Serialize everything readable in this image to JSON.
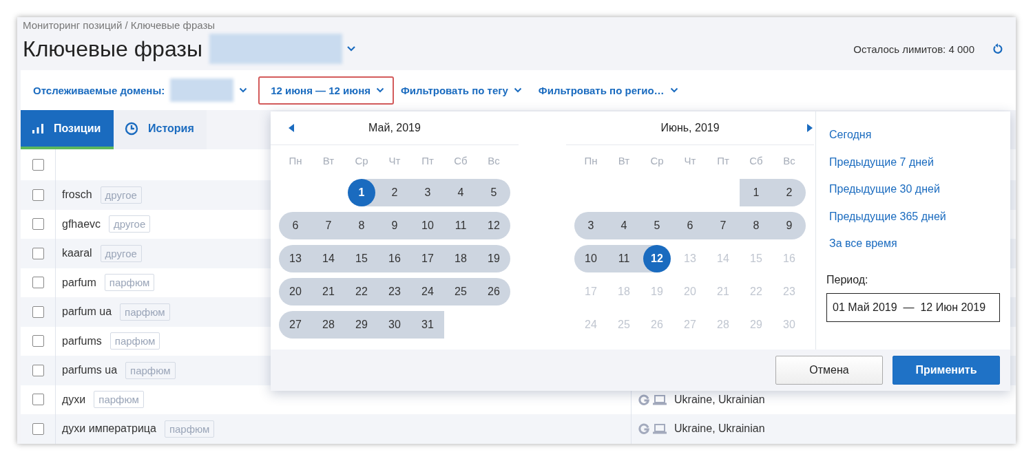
{
  "breadcrumb": "Мониторинг позиций / Ключевые фразы",
  "title": "Ключевые фразы",
  "limits": "Осталось лимитов: 4 000",
  "filters": [
    {
      "kind": "domains",
      "label": "Отслеживаемые домены:",
      "active": false
    },
    {
      "kind": "date",
      "label": "12 июня — 12 июня",
      "active": true
    },
    {
      "kind": "plain",
      "label": "Фильтровать по тегу",
      "active": false
    },
    {
      "kind": "plain",
      "label": "Фильтровать по регио…",
      "active": false
    }
  ],
  "tabs": [
    {
      "kind": "positions",
      "label": "Позиции",
      "selected": true
    },
    {
      "kind": "history",
      "label": "История",
      "selected": false
    }
  ],
  "table": {
    "header_checked": false,
    "rows": [
      {
        "phrase": "frosch",
        "tag": "другое",
        "checked": false
      },
      {
        "phrase": "gfhaevc",
        "tag": "другое",
        "checked": false
      },
      {
        "phrase": "kaaral",
        "tag": "другое",
        "checked": false
      },
      {
        "phrase": "parfum",
        "tag": "парфюм",
        "checked": false
      },
      {
        "phrase": "parfum ua",
        "tag": "парфюм",
        "checked": false
      },
      {
        "phrase": "parfums",
        "tag": "парфюм",
        "checked": false
      },
      {
        "phrase": "parfums ua",
        "tag": "парфюм",
        "checked": false
      },
      {
        "phrase": "духи",
        "tag": "парфюм",
        "checked": false,
        "region": "Ukraine, Ukrainian"
      },
      {
        "phrase": "духи императрица",
        "tag": "парфюм",
        "checked": false,
        "region": "Ukraine, Ukrainian"
      }
    ]
  },
  "datepicker": {
    "months": [
      {
        "title": "Май, 2019",
        "prev": true,
        "next": false,
        "weekdays": [
          "Пн",
          "Вт",
          "Ср",
          "Чт",
          "Пт",
          "Сб",
          "Вс"
        ],
        "weeks": [
          [
            {
              "day": "1",
              "selected": true,
              "in_range": true
            },
            {
              "day": "2",
              "selected": false,
              "in_range": true
            },
            {
              "day": "3",
              "selected": false,
              "in_range": true
            },
            {
              "day": "4",
              "selected": false,
              "in_range": true
            },
            {
              "day": "5",
              "selected": false,
              "in_range": true
            }
          ],
          [
            {
              "day": "6",
              "selected": false,
              "in_range": true
            },
            {
              "day": "7",
              "selected": false,
              "in_range": true
            },
            {
              "day": "8",
              "selected": false,
              "in_range": true
            },
            {
              "day": "9",
              "selected": false,
              "in_range": true
            },
            {
              "day": "10",
              "selected": false,
              "in_range": true
            },
            {
              "day": "11",
              "selected": false,
              "in_range": true
            },
            {
              "day": "12",
              "selected": false,
              "in_range": true
            }
          ],
          [
            {
              "day": "13",
              "selected": false,
              "in_range": true
            },
            {
              "day": "14",
              "selected": false,
              "in_range": true
            },
            {
              "day": "15",
              "selected": false,
              "in_range": true
            },
            {
              "day": "16",
              "selected": false,
              "in_range": true
            },
            {
              "day": "17",
              "selected": false,
              "in_range": true
            },
            {
              "day": "18",
              "selected": false,
              "in_range": true
            },
            {
              "day": "19",
              "selected": false,
              "in_range": true
            }
          ],
          [
            {
              "day": "20",
              "selected": false,
              "in_range": true
            },
            {
              "day": "21",
              "selected": false,
              "in_range": true
            },
            {
              "day": "22",
              "selected": false,
              "in_range": true
            },
            {
              "day": "23",
              "selected": false,
              "in_range": true
            },
            {
              "day": "24",
              "selected": false,
              "in_range": true
            },
            {
              "day": "25",
              "selected": false,
              "in_range": true
            },
            {
              "day": "26",
              "selected": false,
              "in_range": true
            }
          ],
          [
            {
              "day": "27",
              "selected": false,
              "in_range": true
            },
            {
              "day": "28",
              "selected": false,
              "in_range": true
            },
            {
              "day": "29",
              "selected": false,
              "in_range": true
            },
            {
              "day": "30",
              "selected": false,
              "in_range": true
            },
            {
              "day": "31",
              "selected": false,
              "in_range": true
            }
          ]
        ]
      },
      {
        "title": "Июнь, 2019",
        "prev": false,
        "next": true,
        "weekdays": [
          "Пн",
          "Вт",
          "Ср",
          "Чт",
          "Пт",
          "Сб",
          "Вс"
        ],
        "weeks": [
          [
            {
              "day": "1",
              "selected": false,
              "in_range": true
            },
            {
              "day": "2",
              "selected": false,
              "in_range": true
            }
          ],
          [
            {
              "day": "3",
              "selected": false,
              "in_range": true
            },
            {
              "day": "4",
              "selected": false,
              "in_range": true
            },
            {
              "day": "5",
              "selected": false,
              "in_range": true
            },
            {
              "day": "6",
              "selected": false,
              "in_range": true
            },
            {
              "day": "7",
              "selected": false,
              "in_range": true
            },
            {
              "day": "8",
              "selected": false,
              "in_range": true
            },
            {
              "day": "9",
              "selected": false,
              "in_range": true
            }
          ],
          [
            {
              "day": "10",
              "selected": false,
              "in_range": true
            },
            {
              "day": "11",
              "selected": false,
              "in_range": true
            },
            {
              "day": "12",
              "selected": true,
              "in_range": true
            },
            {
              "day": "13",
              "selected": false,
              "in_range": false
            },
            {
              "day": "14",
              "selected": false,
              "in_range": false
            },
            {
              "day": "15",
              "selected": false,
              "in_range": false
            },
            {
              "day": "16",
              "selected": false,
              "in_range": false
            }
          ],
          [
            {
              "day": "17",
              "selected": false,
              "in_range": false
            },
            {
              "day": "18",
              "selected": false,
              "in_range": false
            },
            {
              "day": "19",
              "selected": false,
              "in_range": false
            },
            {
              "day": "20",
              "selected": false,
              "in_range": false
            },
            {
              "day": "21",
              "selected": false,
              "in_range": false
            },
            {
              "day": "22",
              "selected": false,
              "in_range": false
            },
            {
              "day": "23",
              "selected": false,
              "in_range": false
            }
          ],
          [
            {
              "day": "24",
              "selected": false,
              "in_range": false
            },
            {
              "day": "25",
              "selected": false,
              "in_range": false
            },
            {
              "day": "26",
              "selected": false,
              "in_range": false
            },
            {
              "day": "27",
              "selected": false,
              "in_range": false
            },
            {
              "day": "28",
              "selected": false,
              "in_range": false
            },
            {
              "day": "29",
              "selected": false,
              "in_range": false
            },
            {
              "day": "30",
              "selected": false,
              "in_range": false
            }
          ]
        ]
      }
    ],
    "presets": [
      "Сегодня",
      "Предыдущие 7 дней",
      "Предыдущие 30 дней",
      "Предыдущие 365 дней",
      "За все время"
    ],
    "period_label": "Период:",
    "period_value": "01 Май 2019  —  12 Июн 2019",
    "buttons": [
      {
        "kind": "secondary",
        "label": "Отмена"
      },
      {
        "kind": "primary",
        "label": "Применить"
      }
    ]
  }
}
